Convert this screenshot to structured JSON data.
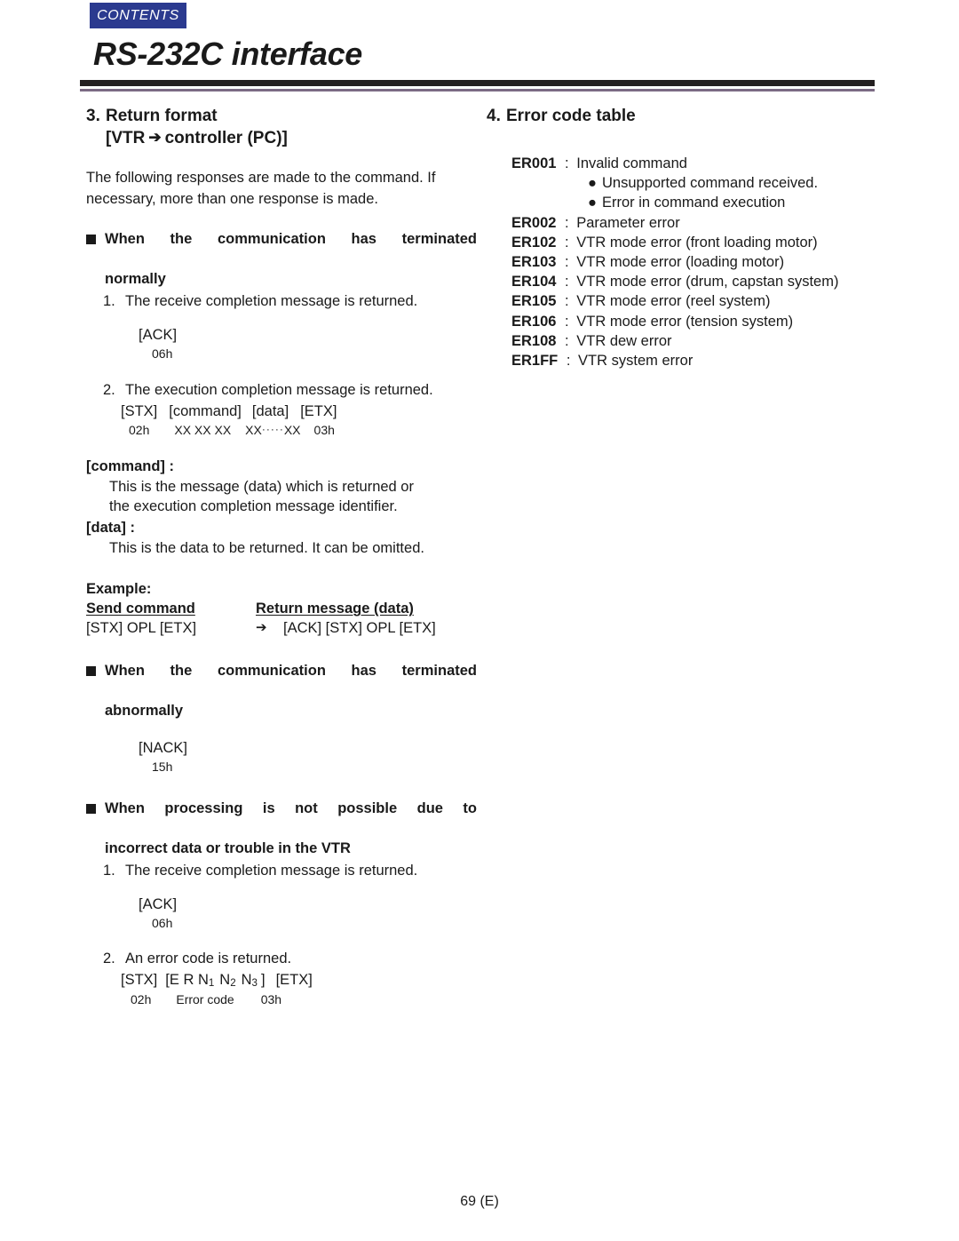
{
  "header": {
    "contents_tab": "CONTENTS",
    "page_title": "RS-232C interface"
  },
  "left_column": {
    "section": {
      "number": "3.",
      "title": "Return format",
      "subtitle_prefix": "[VTR",
      "arrow": "➔",
      "subtitle_suffix": "controller (PC)]"
    },
    "intro": "The following responses are made to the command. If necessary, more than one response is made.",
    "normal_block": {
      "heading_line1": "When the communication has terminated",
      "heading_line2": "normally",
      "step1_num": "1.",
      "step1_text": "The receive completion message is returned.",
      "ack_label": "[ACK]",
      "ack_hex": "06h",
      "step2_num": "2.",
      "step2_text": "The execution completion message is returned.",
      "fmt_stx": "[STX]",
      "fmt_command": "[command]",
      "fmt_data": "[data]",
      "fmt_etx": "[ETX]",
      "hex_stx": "02h",
      "hex_command": "XX XX XX",
      "hex_data_left": "XX",
      "hex_data_dots": "·····",
      "hex_data_right": "XX",
      "hex_etx": "03h"
    },
    "definitions": [
      {
        "term": "[command] :",
        "body_line1": "This is the message (data) which is returned or",
        "body_line2": "the execution completion message identifier."
      },
      {
        "term": "[data] :",
        "body_line1": "This is the data to be returned. It can be omitted.",
        "body_line2": ""
      }
    ],
    "example": {
      "title": "Example:",
      "col1_header": "Send command",
      "col2_header": "Return message (data)",
      "col1_value": "[STX] OPL [ETX]",
      "arrow": "➔",
      "col2_value": "[ACK] [STX] OPL [ETX]"
    },
    "abnormal_block": {
      "heading_line1": "When the communication has terminated",
      "heading_line2": "abnormally",
      "nack_label": "[NACK]",
      "nack_hex": "15h"
    },
    "error_block": {
      "heading_line1": "When processing is not possible due to",
      "heading_line2": "incorrect data or trouble in the VTR",
      "step1_num": "1.",
      "step1_text": "The receive completion message is returned.",
      "ack_label": "[ACK]",
      "ack_hex": "06h",
      "step2_num": "2.",
      "step2_text": "An error code is returned.",
      "fmt_stx": "[STX]",
      "fmt_errcode_open": "[E R N",
      "fmt_sub1": "1",
      "fmt_n2": "N",
      "fmt_sub2": "2",
      "fmt_n3": "N",
      "fmt_sub3": "3",
      "fmt_errcode_close": "]",
      "fmt_etx": "[ETX]",
      "hex_stx": "02h",
      "hex_errcode": "Error code",
      "hex_etx": "03h"
    }
  },
  "right_column": {
    "section": {
      "number": "4.",
      "title": "Error code table"
    },
    "errors": [
      {
        "code": "ER001",
        "sep": ":",
        "desc": "Invalid command"
      },
      {
        "code": "ER002",
        "sep": ":",
        "desc": "Parameter error"
      },
      {
        "code": "ER102",
        "sep": ":",
        "desc": "VTR mode error (front loading motor)"
      },
      {
        "code": "ER103",
        "sep": ":",
        "desc": "VTR mode error (loading motor)"
      },
      {
        "code": "ER104",
        "sep": ":",
        "desc": "VTR mode error (drum, capstan system)"
      },
      {
        "code": "ER105",
        "sep": ":",
        "desc": "VTR mode error (reel system)"
      },
      {
        "code": "ER106",
        "sep": ":",
        "desc": "VTR mode error (tension system)"
      },
      {
        "code": "ER108",
        "sep": ":",
        "desc": "VTR dew error"
      },
      {
        "code": "ER1FF",
        "sep": ":",
        "desc": "VTR system error"
      }
    ],
    "er001_bullets": [
      "Unsupported command received.",
      "Error in command execution"
    ]
  },
  "footer": {
    "page_number": "69 (E)"
  },
  "colors": {
    "contents_tab_bg": "#2b3a8f",
    "rule_dark": "#231f20",
    "rule_purple": "#7b6a84",
    "text": "#1a1a1a"
  }
}
